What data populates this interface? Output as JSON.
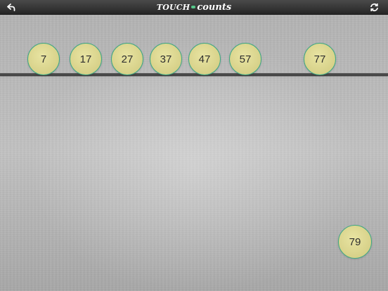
{
  "header": {
    "title_part1": "TOUCH",
    "title_part2": "counts",
    "back_icon": "back-arrow-icon",
    "refresh_icon": "refresh-icon"
  },
  "colors": {
    "ball_fill": "#dcd68e",
    "ball_border": "#3ea884",
    "brand_dot": "#56c78a"
  },
  "shelf_balls": [
    "7",
    "17",
    "27",
    "37",
    "47",
    "57",
    "77"
  ],
  "loose_ball": "79"
}
